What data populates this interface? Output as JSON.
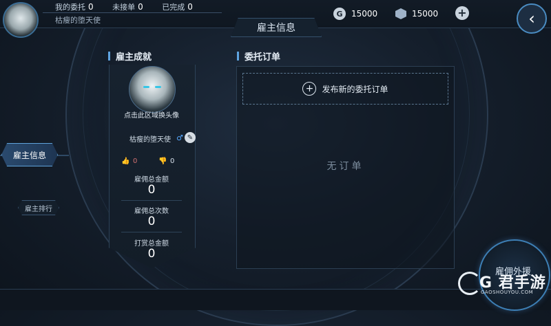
{
  "header": {
    "stats": [
      {
        "label": "我的委托",
        "value": "0"
      },
      {
        "label": "未接单",
        "value": "0"
      },
      {
        "label": "已完成",
        "value": "0"
      }
    ],
    "username": "枯瘦的堕天使",
    "currency_gold": "15000",
    "currency_gold_symbol": "G",
    "currency_gem": "15000",
    "add_symbol": "+",
    "back_symbol": "‹"
  },
  "page_title": "雇主信息",
  "left_nav": {
    "items": [
      {
        "label": "雇主信息",
        "active": true
      },
      {
        "label": "雇主排行",
        "active": false
      }
    ]
  },
  "achievements": {
    "title": "雇主成就",
    "change_avatar_hint": "点击此区域换头像",
    "name": "枯瘦的堕天使",
    "gender_symbol": "♂",
    "likes": "0",
    "dislikes": "0",
    "stats": [
      {
        "label": "雇佣总金额",
        "value": "0"
      },
      {
        "label": "雇佣总次数",
        "value": "0"
      },
      {
        "label": "打赏总金额",
        "value": "0"
      }
    ]
  },
  "orders": {
    "title": "委托订单",
    "new_order_label": "发布新的委托订单",
    "empty_text": "无订单"
  },
  "radar_label": "雇佣外援",
  "watermark": {
    "brand": "G 君手游",
    "domain": "GAOSHOUYOU.COM"
  },
  "colors": {
    "accent": "#5ea4e0",
    "like": "#d07070",
    "male": "#57a8ff"
  }
}
